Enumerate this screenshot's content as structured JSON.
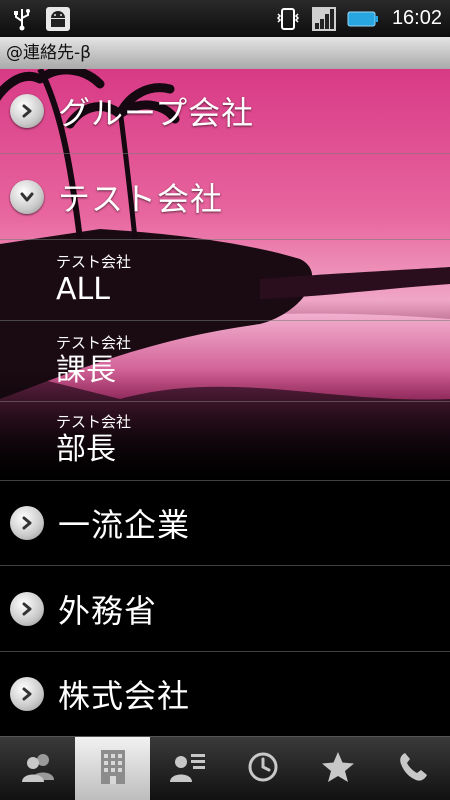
{
  "status_bar": {
    "time": "16:02",
    "icons": [
      "usb-icon",
      "android-debug-icon",
      "vibrate-icon",
      "signal-icon",
      "battery-icon"
    ]
  },
  "app": {
    "title": "@連絡先-β"
  },
  "list": {
    "groups": [
      {
        "label": "グループ会社",
        "expanded": false
      },
      {
        "label": "テスト会社",
        "expanded": true
      }
    ],
    "sub_items": [
      {
        "company": "テスト会社",
        "title": "ALL"
      },
      {
        "company": "テスト会社",
        "title": "課長"
      },
      {
        "company": "テスト会社",
        "title": "部長"
      }
    ],
    "more_groups": [
      {
        "label": "一流企業",
        "expanded": false
      },
      {
        "label": "外務省",
        "expanded": false
      },
      {
        "label": "株式会社",
        "expanded": false
      }
    ]
  },
  "tabs": [
    {
      "name": "contacts-tab",
      "icon": "people-icon",
      "active": false
    },
    {
      "name": "groups-tab",
      "icon": "building-icon",
      "active": true
    },
    {
      "name": "lists-tab",
      "icon": "contact-list-icon",
      "active": false
    },
    {
      "name": "history-tab",
      "icon": "clock-icon",
      "active": false
    },
    {
      "name": "favorites-tab",
      "icon": "star-icon",
      "active": false
    },
    {
      "name": "phone-tab",
      "icon": "phone-icon",
      "active": false
    }
  ],
  "colors": {
    "accent_pink": "#e0408a",
    "title_bar": "#c8c8c8",
    "battery": "#28a6e0"
  }
}
